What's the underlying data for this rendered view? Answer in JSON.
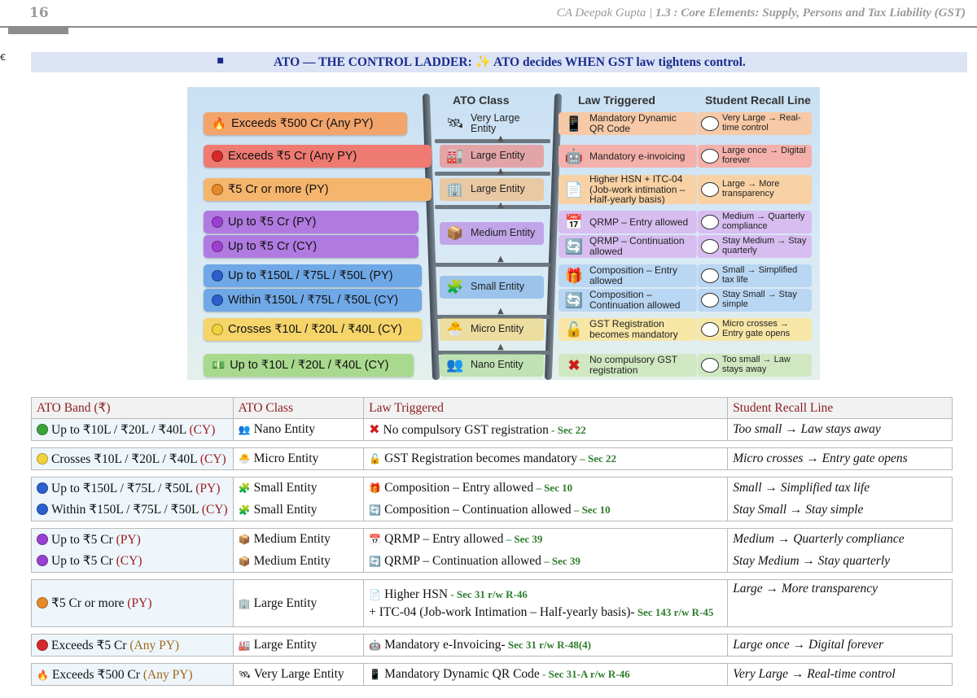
{
  "header": {
    "page_number": "16",
    "author": "CA Deepak Gupta |",
    "chapter": "1.3 : Core Elements: Supply, Persons and Tax Liability (GST)"
  },
  "side_mark": "ꞓ",
  "heading": {
    "bullet": "▪",
    "text": "ATO — THE CONTROL LADDER: ",
    "spark": "✨",
    "text2": " ATO decides WHEN GST law tightens control."
  },
  "infographic": {
    "headers": {
      "class": "ATO Class",
      "law": "Law Triggered",
      "recall": "Student Recall Line"
    },
    "bands": [
      {
        "label": "Exceeds ₹500 Cr (Any PY)",
        "icon": "🔥",
        "color": "#f2a46b"
      },
      {
        "label": "Exceeds ₹5 Cr (Any PY)",
        "icon": "red-dot",
        "color": "#ef7a72"
      },
      {
        "label": "₹5 Cr or more (PY)",
        "icon": "orange-dot",
        "color": "#f6b56d"
      },
      {
        "label": "Up to ₹5 Cr (PY)",
        "icon": "purple-dot",
        "color": "#b07ae0"
      },
      {
        "label": "Up to ₹5 Cr (CY)",
        "icon": "purple-dot",
        "color": "#b07ae0"
      },
      {
        "label": "Up to ₹150L / ₹75L / ₹50L (PY)",
        "icon": "blue-dot",
        "color": "#6fa8e6"
      },
      {
        "label": "Within ₹150L / ₹75L / ₹50L (CY)",
        "icon": "blue-dot",
        "color": "#6fa8e6"
      },
      {
        "label": "Crosses ₹10L / ₹20L / ₹40L (CY)",
        "icon": "yellow-dot",
        "color": "#f5d46a"
      },
      {
        "label": "Up to ₹10L / ₹20L / ₹40L (CY)",
        "icon": "money-icon",
        "color": "#a9d98e"
      }
    ],
    "classes": [
      "Very Large Entity",
      "Large Entity",
      "Large Entity",
      "Medium Entity",
      "Small Entity",
      "Micro Entity",
      "Nano Entity"
    ],
    "laws": [
      "Mandatory Dynamic QR Code",
      "Mandatory e-invoicing",
      "Higher HSN + ITC-04 (Job-work intimation – Half-yearly basis)",
      "QRMP – Entry allowed",
      "QRMP – Continuation allowed",
      "Composition – Entry allowed",
      "Composition – Continuation allowed",
      "GST Registration becomes mandatory",
      "No compulsory GST registration"
    ],
    "recalls": [
      "Very Large → Real-time control",
      "Large once → Digital forever",
      "Large → More transparency",
      "Medium → Quarterly compliance",
      "Stay Medium → Stay quarterly",
      "Small → Simplified tax life",
      "Stay Small → Stay simple",
      "Micro crosses → Entry gate opens",
      "Too small → Law stays away"
    ]
  },
  "table": {
    "headers": [
      "ATO Band (₹)",
      "ATO Class",
      "Law Triggered",
      "Student Recall Line"
    ],
    "rows": [
      {
        "dot": "#3aa33a",
        "band": "Up to ₹10L / ₹20L / ₹40L ",
        "tag": "(CY)",
        "tagColor": "red",
        "clsIcon": "👥",
        "cls": "Nano Entity",
        "lawIcon": "✖",
        "law": "No compulsory GST registration",
        "sec": " - Sec 22",
        "recall": "Too small → Law stays away",
        "group": "single"
      },
      {
        "dot": "#f2d23a",
        "band": "Crosses ₹10L / ₹20L / ₹40L ",
        "tag": "(CY)",
        "tagColor": "red",
        "clsIcon": "🐣",
        "cls": "Micro Entity",
        "lawIcon": "🔓",
        "law": "GST Registration becomes mandatory",
        "sec": " – Sec 22",
        "recall": "Micro crosses → Entry gate opens",
        "group": "single"
      },
      {
        "dot": "#2c5fcc",
        "band": "Up to ₹150L / ₹75L / ₹50L ",
        "tag": "(PY)",
        "tagColor": "red",
        "clsIcon": "🧩",
        "cls": "Small Entity",
        "lawIcon": "🎁",
        "law": "Composition – Entry allowed",
        "sec": " – Sec 10",
        "recall": "Small → Simplified tax life",
        "group": "top"
      },
      {
        "dot": "#2c5fcc",
        "band": "Within ₹150L / ₹75L / ₹50L ",
        "tag": "(CY)",
        "tagColor": "red",
        "clsIcon": "🧩",
        "cls": "Small Entity",
        "lawIcon": "🔄",
        "law": "Composition – Continuation allowed",
        "sec": " – Sec 10",
        "recall": "Stay Small → Stay simple",
        "group": "bot"
      },
      {
        "dot": "#9b3fd1",
        "band": "Up to ₹5 Cr ",
        "tag": "(PY)",
        "tagColor": "red",
        "clsIcon": "📦",
        "cls": "Medium Entity",
        "lawIcon": "📅",
        "law": "QRMP – Entry allowed",
        "sec": " – Sec 39",
        "recall": "Medium → Quarterly compliance",
        "group": "top"
      },
      {
        "dot": "#9b3fd1",
        "band": "Up to ₹5 Cr ",
        "tag": "(CY)",
        "tagColor": "red",
        "clsIcon": "📦",
        "cls": "Medium Entity",
        "lawIcon": "🔄",
        "law": "QRMP – Continuation allowed",
        "sec": " – Sec 39",
        "recall": "Stay Medium → Stay quarterly",
        "group": "bot"
      },
      {
        "dot": "#e58a2a",
        "band": "₹5 Cr or more ",
        "tag": "(PY)",
        "tagColor": "red",
        "clsIcon": "🏢",
        "cls": "Large Entity",
        "lawIcon": "📄",
        "law": "Higher HSN",
        "sec": " - Sec 31 r/w R-46",
        "law2": "+ ITC-04 (Job-work Intimation – Half-yearly basis)-",
        "sec2": " Sec 143 r/w R-45",
        "recall": "Large → More transparency",
        "group": "single"
      },
      {
        "dot": "#d62a2a",
        "band": "Exceeds ₹5 Cr ",
        "tag": "(Any PY)",
        "tagColor": "gold",
        "clsIcon": "🏭",
        "cls": "Large Entity",
        "lawIcon": "🤖",
        "law": "Mandatory e-Invoicing-",
        "sec": " Sec 31 r/w R-48(4)",
        "recall": "Large once → Digital forever",
        "group": "single"
      },
      {
        "dot": "fire",
        "band": "Exceeds ₹500 Cr ",
        "tag": "(Any PY)",
        "tagColor": "gold",
        "clsIcon": "🛰",
        "cls": "Very Large Entity",
        "lawIcon": "📱",
        "law": "Mandatory Dynamic QR Code",
        "sec": " - Sec 31-A r/w R-46",
        "recall": "Very Large → Real-time control",
        "group": "single"
      }
    ]
  }
}
